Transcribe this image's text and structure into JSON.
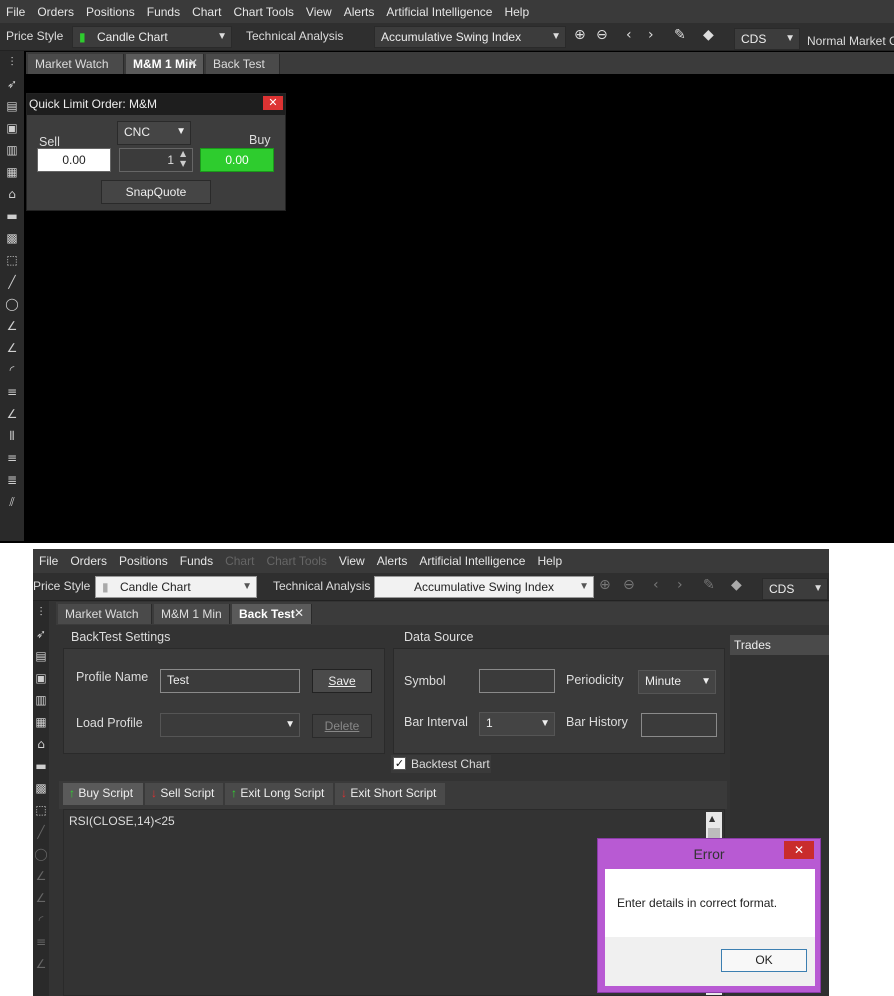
{
  "menu": [
    "File",
    "Orders",
    "Positions",
    "Funds",
    "Chart",
    "Chart Tools",
    "View",
    "Alerts",
    "Artificial Intelligence",
    "Help"
  ],
  "toolbar": {
    "price_style_label": "Price Style",
    "price_style_value": "Candle Chart",
    "technical_analysis_label": "Technical Analysis",
    "technical_analysis_value": "Accumulative Swing Index",
    "exchange_value": "CDS",
    "market_value": "Normal Market C"
  },
  "top_tabs": [
    {
      "label": "Market Watch"
    },
    {
      "label": "M&M 1 Min"
    },
    {
      "label": "Back Test"
    }
  ],
  "quick_order": {
    "title": "Quick Limit Order: M&M",
    "product": "CNC",
    "sell_label": "Sell",
    "buy_label": "Buy",
    "sell_value": "0.00",
    "buy_value": "0.00",
    "quantity": "1",
    "snapquote_label": "SnapQuote",
    "colors": {
      "buy_bg": "#2ecc2e"
    }
  },
  "bottom_tabs": [
    {
      "label": "Market Watch"
    },
    {
      "label": "M&M 1 Min"
    },
    {
      "label": "Back Test"
    }
  ],
  "backtest": {
    "settings_title": "BackTest Settings",
    "profile_name_label": "Profile Name",
    "profile_name_value": "Test",
    "save_label": "Save",
    "load_profile_label": "Load Profile",
    "delete_label": "Delete",
    "data_source_title": "Data Source",
    "symbol_label": "Symbol",
    "periodicity_label": "Periodicity",
    "periodicity_value": "Minute",
    "bar_interval_label": "Bar Interval",
    "bar_interval_value": "1",
    "bar_history_label": "Bar History",
    "backtest_chart_label": "Backtest Chart",
    "trades_label": "Trades",
    "script_tabs": [
      "Buy Script",
      "Sell Script",
      "Exit Long Script",
      "Exit Short Script"
    ],
    "script_text": "RSI(CLOSE,14)<25"
  },
  "error_dialog": {
    "title": "Error",
    "message": "Enter details in correct format.",
    "ok_label": "OK"
  }
}
